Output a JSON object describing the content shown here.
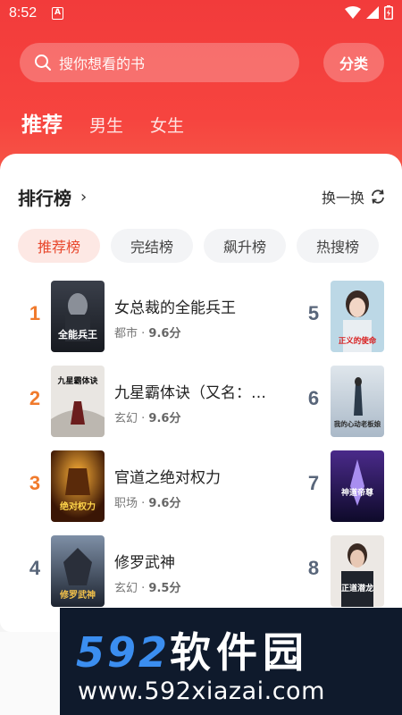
{
  "status_bar": {
    "time": "8:52",
    "notice_icon": "A"
  },
  "search": {
    "placeholder": "搜你想看的书"
  },
  "category_button": "分类",
  "tabs": [
    {
      "label": "推荐",
      "active": true
    },
    {
      "label": "男生",
      "active": false
    },
    {
      "label": "女生",
      "active": false
    }
  ],
  "ranking": {
    "title": "排行榜",
    "refresh_label": "换一换",
    "pills": [
      {
        "label": "推荐榜",
        "active": true
      },
      {
        "label": "完结榜",
        "active": false
      },
      {
        "label": "飙升榜",
        "active": false
      },
      {
        "label": "热搜榜",
        "active": false
      }
    ],
    "books_left": [
      {
        "rank": "1",
        "title": "女总裁的全能兵王",
        "genre": "都市",
        "score": "9.6分",
        "rank_color": "#f07a2c",
        "cover_text": "全能兵王"
      },
      {
        "rank": "2",
        "title": "九星霸体诀（又名：…",
        "genre": "玄幻",
        "score": "9.6分",
        "rank_color": "#f07a2c",
        "cover_text": "九星霸体诀"
      },
      {
        "rank": "3",
        "title": "官道之绝对权力",
        "genre": "职场",
        "score": "9.6分",
        "rank_color": "#f07a2c",
        "cover_text": "绝对权力"
      },
      {
        "rank": "4",
        "title": "修罗武神",
        "genre": "玄幻",
        "score": "9.5分",
        "rank_color": "#59667a",
        "cover_text": "修罗武神"
      }
    ],
    "books_right": [
      {
        "rank": "5",
        "cover_text": "正义的使命"
      },
      {
        "rank": "6",
        "cover_text": "我的心动老板娘"
      },
      {
        "rank": "7",
        "cover_text": "神道帝尊"
      },
      {
        "rank": "8",
        "cover_text": "正道潜龙"
      }
    ]
  },
  "watermark": {
    "big_num": "592",
    "big_cn": "软件园",
    "url": "www.592xiazai.com"
  },
  "colors": {
    "header_red": "#f23b3b",
    "accent": "#e8482d",
    "rank_orange": "#f07a2c",
    "rank_gray": "#59667a"
  }
}
